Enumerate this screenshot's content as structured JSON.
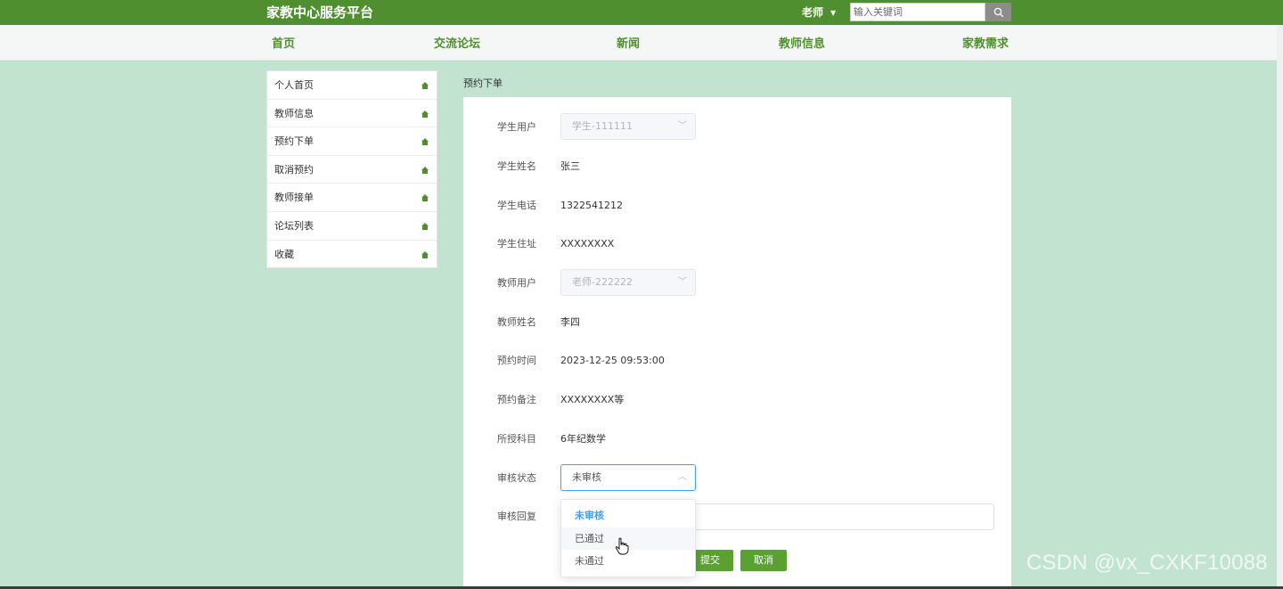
{
  "header": {
    "brand": "家教中心服务平台",
    "user_label": "老师",
    "search_placeholder": "输入关键词"
  },
  "nav": [
    "首页",
    "交流论坛",
    "新闻",
    "教师信息",
    "家教需求"
  ],
  "sidebar": {
    "items": [
      {
        "label": "个人首页"
      },
      {
        "label": "教师信息"
      },
      {
        "label": "预约下单"
      },
      {
        "label": "取消预约"
      },
      {
        "label": "教师接单"
      },
      {
        "label": "论坛列表"
      },
      {
        "label": "收藏"
      }
    ]
  },
  "page": {
    "title": "预约下单"
  },
  "form": {
    "student_user": {
      "label": "学生用户",
      "value": "学生-111111"
    },
    "student_name": {
      "label": "学生姓名",
      "value": "张三"
    },
    "student_phone": {
      "label": "学生电话",
      "value": "1322541212"
    },
    "student_address": {
      "label": "学生住址",
      "value": "XXXXXXXX"
    },
    "teacher_user": {
      "label": "教师用户",
      "value": "老师-222222"
    },
    "teacher_name": {
      "label": "教师姓名",
      "value": "李四"
    },
    "booking_time": {
      "label": "预约时间",
      "value": "2023-12-25 09:53:00"
    },
    "booking_note": {
      "label": "预约备注",
      "value": "XXXXXXXX等"
    },
    "subject": {
      "label": "所授科目",
      "value": "6年纪数学"
    },
    "review_status": {
      "label": "审核状态",
      "value": "未审核"
    },
    "review_reply": {
      "label": "审核回复",
      "value": ""
    },
    "submit_label": "提交",
    "cancel_label": "取消"
  },
  "dropdown": {
    "options": [
      "未审核",
      "已通过",
      "未通过"
    ]
  },
  "watermark": "CSDN @vx_CXKF10088",
  "colors": {
    "brand_green": "#4f8f2f",
    "page_bg": "#c2e3d0",
    "button_green": "#5aa132",
    "select_focus": "#409eff"
  }
}
